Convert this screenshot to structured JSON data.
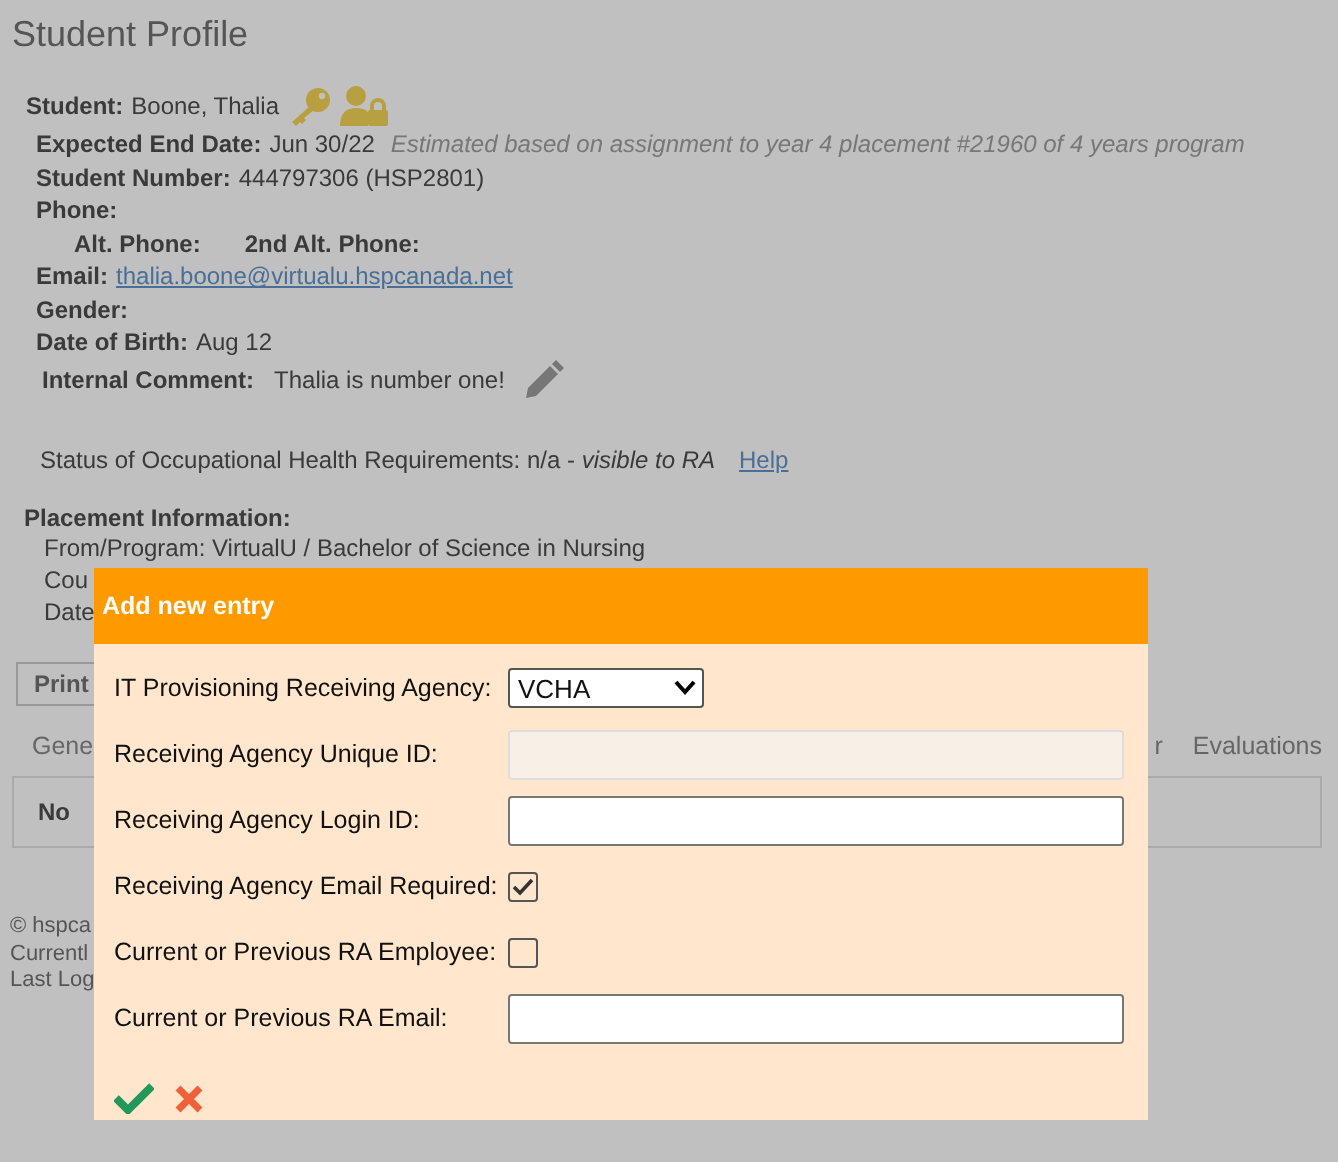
{
  "page": {
    "title": "Student Profile"
  },
  "profile": {
    "student_label": "Student:",
    "student": "Boone, Thalia",
    "end_label": "Expected End Date:",
    "end": "Jun 30/22",
    "end_note": "Estimated based on assignment to year 4 placement #21960 of 4 years program",
    "number_label": "Student Number:",
    "number": "444797306  (HSP2801)",
    "phone_label": "Phone:",
    "alt_phone_label": "Alt. Phone:",
    "alt2_phone_label": "2nd Alt. Phone:",
    "email_label": "Email:",
    "email": "thalia.boone@virtualu.hspcanada.net",
    "gender_label": "Gender:",
    "dob_label": "Date of Birth:",
    "dob": "Aug 12",
    "comment_label": "Internal Comment:",
    "comment": "Thalia is number one!",
    "status": "Status of Occupational Health Requirements: n/a - ",
    "status_note": "visible to RA",
    "help": "Help"
  },
  "placement": {
    "title": "Placement Information:",
    "lines": [
      "From/Program: VirtualU / Bachelor of Science in Nursing",
      "Cou",
      "Date"
    ]
  },
  "print_button": "Print",
  "tabs": [
    {
      "label": "Gene",
      "selected": false
    },
    {
      "label": "r",
      "selected": false
    },
    {
      "label": "Evaluations",
      "selected": false
    }
  ],
  "tab_panel": "No",
  "footer": [
    "© hspca",
    "Currentl",
    "Last Log"
  ],
  "dialog": {
    "title": "Add new entry",
    "fields": [
      {
        "kind": "select",
        "label": "IT Provisioning Receiving Agency:",
        "value": "VCHA"
      },
      {
        "kind": "text",
        "label": "Receiving Agency Unique ID:",
        "disabled": true
      },
      {
        "kind": "text",
        "label": "Receiving Agency Login ID:",
        "disabled": false
      },
      {
        "kind": "checkbox",
        "label": "Receiving Agency Email Required:",
        "checked": true
      },
      {
        "kind": "checkbox",
        "label": "Current or Previous RA Employee:",
        "checked": false
      },
      {
        "kind": "text",
        "label": "Current or Previous RA Email:",
        "disabled": false
      }
    ]
  }
}
